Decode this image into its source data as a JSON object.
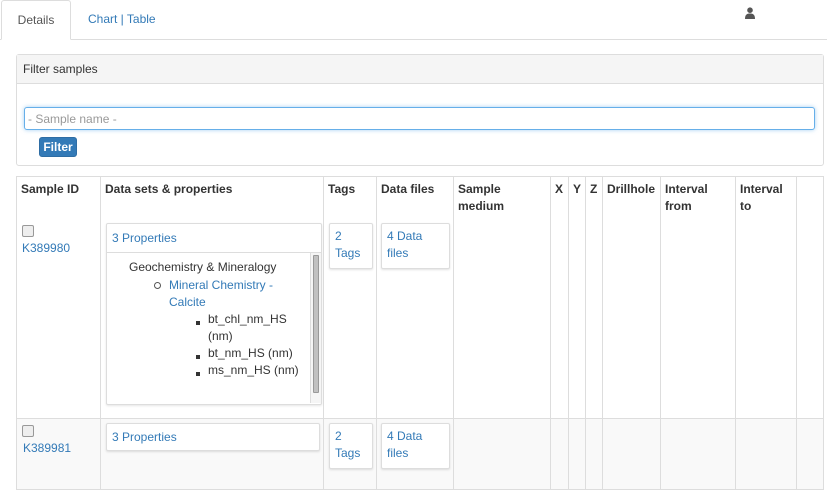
{
  "tabs": [
    {
      "label": "Details",
      "active": true
    },
    {
      "label": "Chart | Table",
      "active": false
    }
  ],
  "user_icon": "user-icon",
  "filter_panel": {
    "heading": "Filter samples",
    "search_placeholder": "- Sample name -",
    "filter_button": "Filter"
  },
  "table": {
    "columns": [
      "Sample ID",
      "Data sets & properties",
      "Tags",
      "Data files",
      "Sample medium",
      "X",
      "Y",
      "Z",
      "Drillhole",
      "Interval from",
      "Interval to"
    ],
    "rows": [
      {
        "sample_id": "K389980",
        "properties_label": "3 Properties",
        "expanded": true,
        "tree": {
          "category": "Geochemistry & Mineralogy",
          "dataset": "Mineral Chemistry - Calcite",
          "properties": [
            "bt_chl_nm_HS (nm)",
            "bt_nm_HS (nm)",
            "ms_nm_HS (nm)"
          ]
        },
        "tags_label": "2 Tags",
        "data_files_label": "4 Data files"
      },
      {
        "sample_id": "K389981",
        "properties_label": "3 Properties",
        "expanded": false,
        "tags_label": "2 Tags",
        "data_files_label": "4 Data files"
      }
    ]
  },
  "colors": {
    "link": "#337ab7",
    "border": "#dddddd",
    "button": "#337ab7"
  }
}
